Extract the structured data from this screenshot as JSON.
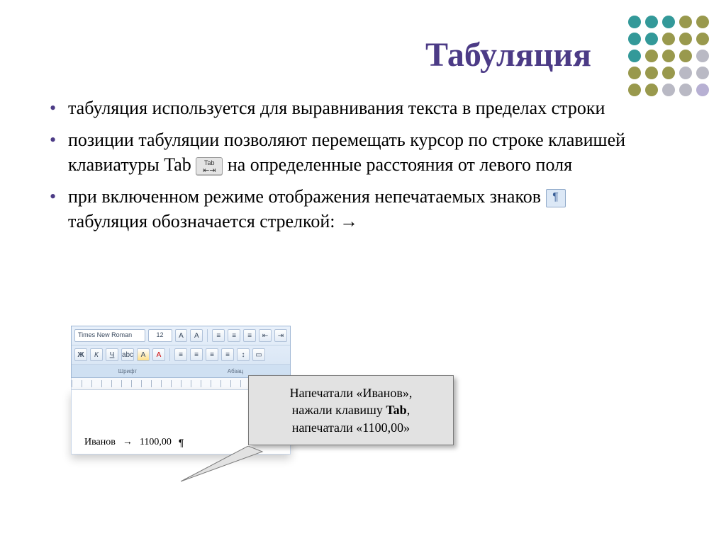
{
  "title": "Табуляция",
  "bullets": {
    "b1": "табуляция используется для выравнивания текста в пределах строки",
    "b2a": "позиции табуляции позволяют перемещать курсор по строке клавишей клавиатуры Tab ",
    "b2b": " на определенные расстояния от левого поля",
    "b3a": "при включенном режиме отображения непечатаемых знаков ",
    "b3b": " табуляция обозначается стрелкой: →"
  },
  "tab_key": {
    "label": "Tab",
    "arrows": "⇤⇥"
  },
  "pilcrow_glyph": "¶",
  "ribbon": {
    "font_name": "Times New Roman",
    "font_size": "12",
    "group_font": "Шрифт",
    "group_para": "Абзац"
  },
  "doc": {
    "name": "Иванов",
    "tab_arrow": "→",
    "value": "1100,00",
    "end": "¶"
  },
  "callout": {
    "line1": "Напечатали «Иванов»,",
    "line2a": "нажали клавишу ",
    "line2b_bold": "Tab",
    "line2c": ",",
    "line3": "напечатали «1100,00»"
  }
}
